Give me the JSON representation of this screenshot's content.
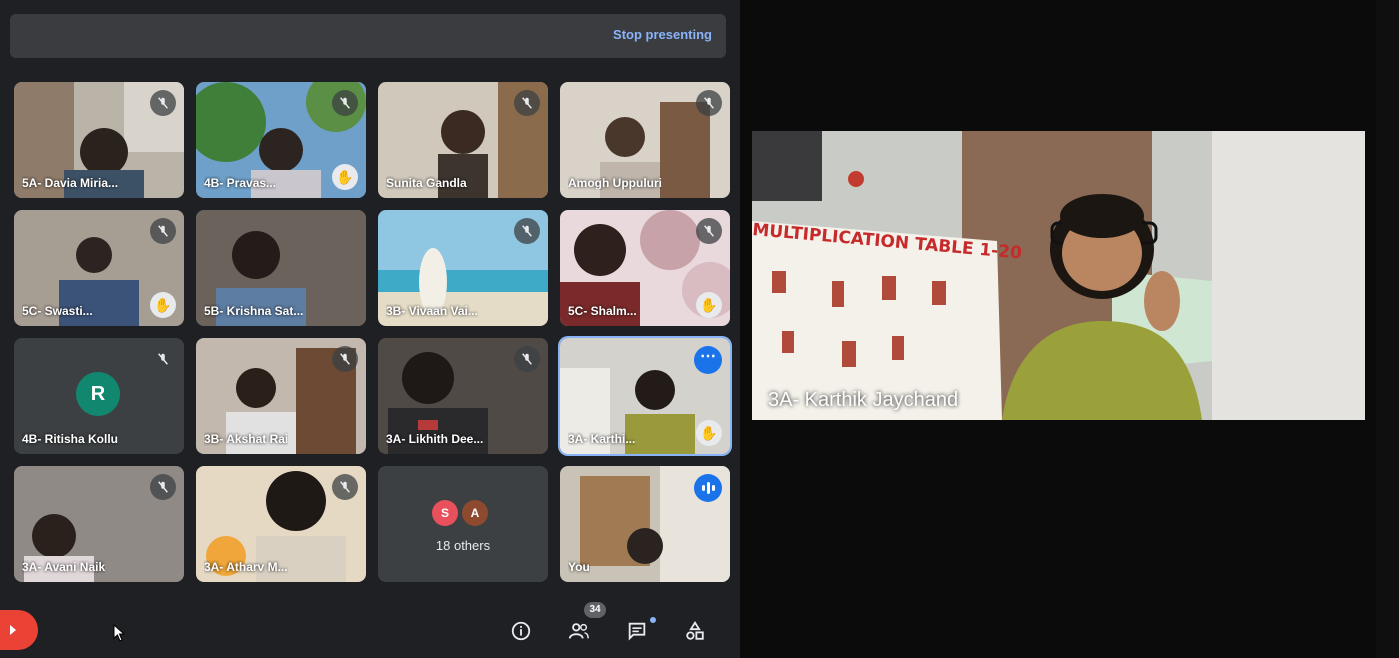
{
  "presentation": {
    "stop_label": "Stop presenting"
  },
  "tiles": [
    {
      "name": "5A- Davia Miria...",
      "mic": "muted"
    },
    {
      "name": "4B- Pravas...",
      "mic": "muted",
      "hand": true
    },
    {
      "name": "Sunita Gandla",
      "mic": "muted"
    },
    {
      "name": "Amogh Uppuluri",
      "mic": "muted"
    },
    {
      "name": "5C- Swasti...",
      "mic": "muted",
      "hand": true
    },
    {
      "name": "5B- Krishna Sat...",
      "mic": "none"
    },
    {
      "name": "3B- Vivaan Vai...",
      "mic": "muted"
    },
    {
      "name": "5C- Shalm...",
      "mic": "muted",
      "hand": true
    },
    {
      "name": "4B- Ritisha Kollu",
      "mic": "muted",
      "avatar": "R"
    },
    {
      "name": "3B- Akshat Rai",
      "mic": "muted"
    },
    {
      "name": "3A- Likhith Dee...",
      "mic": "muted"
    },
    {
      "name": "3A- Karthi...",
      "more": true,
      "hand": true
    },
    {
      "name": "3A- Avani Naik",
      "mic": "muted"
    },
    {
      "name": "3A- Atharv M...",
      "mic": "muted"
    },
    {
      "name": "",
      "others_count_label": "18 others",
      "avatars": [
        "S",
        "A"
      ]
    },
    {
      "name": "You",
      "speaking": true
    }
  ],
  "featured": {
    "name": "3A- Karthik Jaychand",
    "poster_text": "MULTIPLICATION TABLE 1-20"
  },
  "toolbar": {
    "participants_count": "34"
  },
  "colors": {
    "accent": "#8ab4f8",
    "end_call": "#ea4335",
    "avatar_r": "#12876f",
    "avatar_s": "#e8505b",
    "avatar_a": "#8d4a2f"
  }
}
